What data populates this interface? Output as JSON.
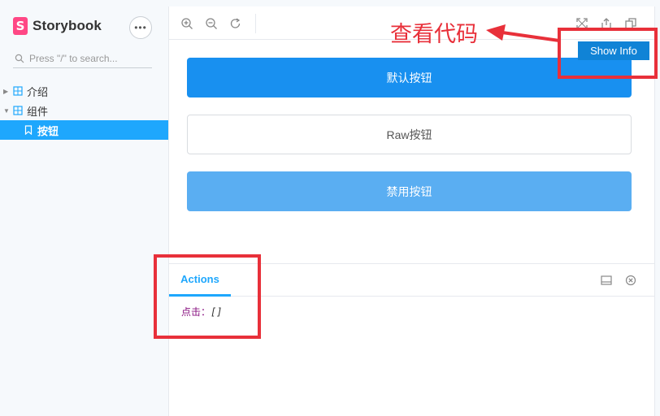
{
  "sidebar": {
    "brand_logo": "S",
    "brand_name": "Storybook",
    "more_label": "•••",
    "search_placeholder": "Press \"/\" to search...",
    "tree": [
      {
        "label": "介绍",
        "expanded": false
      },
      {
        "label": "组件",
        "expanded": true
      },
      {
        "label": "按钮",
        "selected": true
      }
    ]
  },
  "toolbar": {
    "left_icons": [
      "zoom-in-icon",
      "zoom-out-icon",
      "reset-zoom-icon"
    ],
    "right_icons": [
      "fullscreen-icon",
      "share-icon",
      "copy-icon"
    ]
  },
  "canvas": {
    "default_button": "默认按钮",
    "raw_button": "Raw按钮",
    "disabled_button": "禁用按钮",
    "show_info": "Show Info"
  },
  "addon": {
    "tab_actions": "Actions",
    "log_label": "点击：",
    "log_value": "[]"
  },
  "annotation": {
    "text": "查看代码",
    "color": "#e8303a"
  },
  "colors": {
    "accent": "#1ea7fd",
    "primary_button": "#1890f0",
    "disabled_button": "#5aaef2",
    "brand": "#ff4785"
  }
}
